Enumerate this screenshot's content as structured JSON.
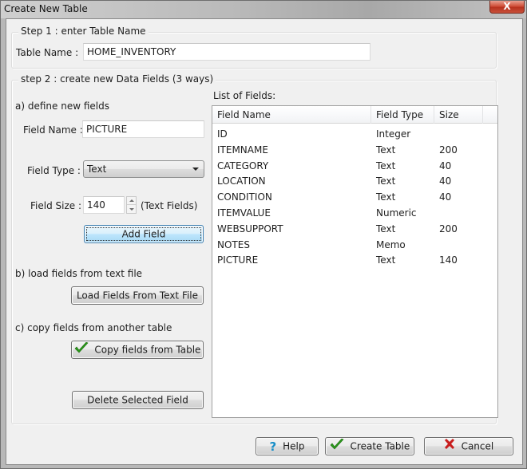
{
  "window": {
    "title": "Create New Table",
    "close_glyph": "X"
  },
  "step1": {
    "legend": "Step 1 : enter Table Name",
    "table_name_label": "Table Name :",
    "table_name_value": "HOME_INVENTORY"
  },
  "step2": {
    "legend": "step 2 : create new Data Fields (3 ways)",
    "section_a": {
      "heading": "a) define new fields",
      "field_name_label": "Field Name :",
      "field_name_value": "PICTURE",
      "field_type_label": "Field Type :",
      "field_type_value": "Text",
      "field_size_label": "Field Size :",
      "field_size_value": "140",
      "field_size_hint": "(Text Fields)",
      "add_field_button": "Add Field"
    },
    "section_b": {
      "heading": "b) load fields from text file",
      "load_button": "Load Fields From Text File"
    },
    "section_c": {
      "heading": "c) copy fields from another table",
      "copy_button": "Copy fields from Table",
      "copy_icon": "checkmark-icon"
    },
    "delete_button": "Delete Selected Field",
    "list": {
      "label": "List of Fields:",
      "columns": [
        "Field Name",
        "Field Type",
        "Size"
      ],
      "rows": [
        {
          "name": "ID",
          "type": "Integer",
          "size": ""
        },
        {
          "name": "ITEMNAME",
          "type": "Text",
          "size": "200"
        },
        {
          "name": "CATEGORY",
          "type": "Text",
          "size": "40"
        },
        {
          "name": "LOCATION",
          "type": "Text",
          "size": "40"
        },
        {
          "name": "CONDITION",
          "type": "Text",
          "size": "40"
        },
        {
          "name": "ITEMVALUE",
          "type": "Numeric",
          "size": ""
        },
        {
          "name": "WEBSUPPORT",
          "type": "Text",
          "size": "200"
        },
        {
          "name": "NOTES",
          "type": "Memo",
          "size": ""
        },
        {
          "name": "PICTURE",
          "type": "Text",
          "size": "140"
        }
      ]
    }
  },
  "footer": {
    "help_button": "Help",
    "create_button": "Create Table",
    "cancel_button": "Cancel"
  },
  "colors": {
    "check_green": "#2a9a1a",
    "cancel_red": "#c81e1e",
    "help_blue": "#1a8fc8"
  }
}
